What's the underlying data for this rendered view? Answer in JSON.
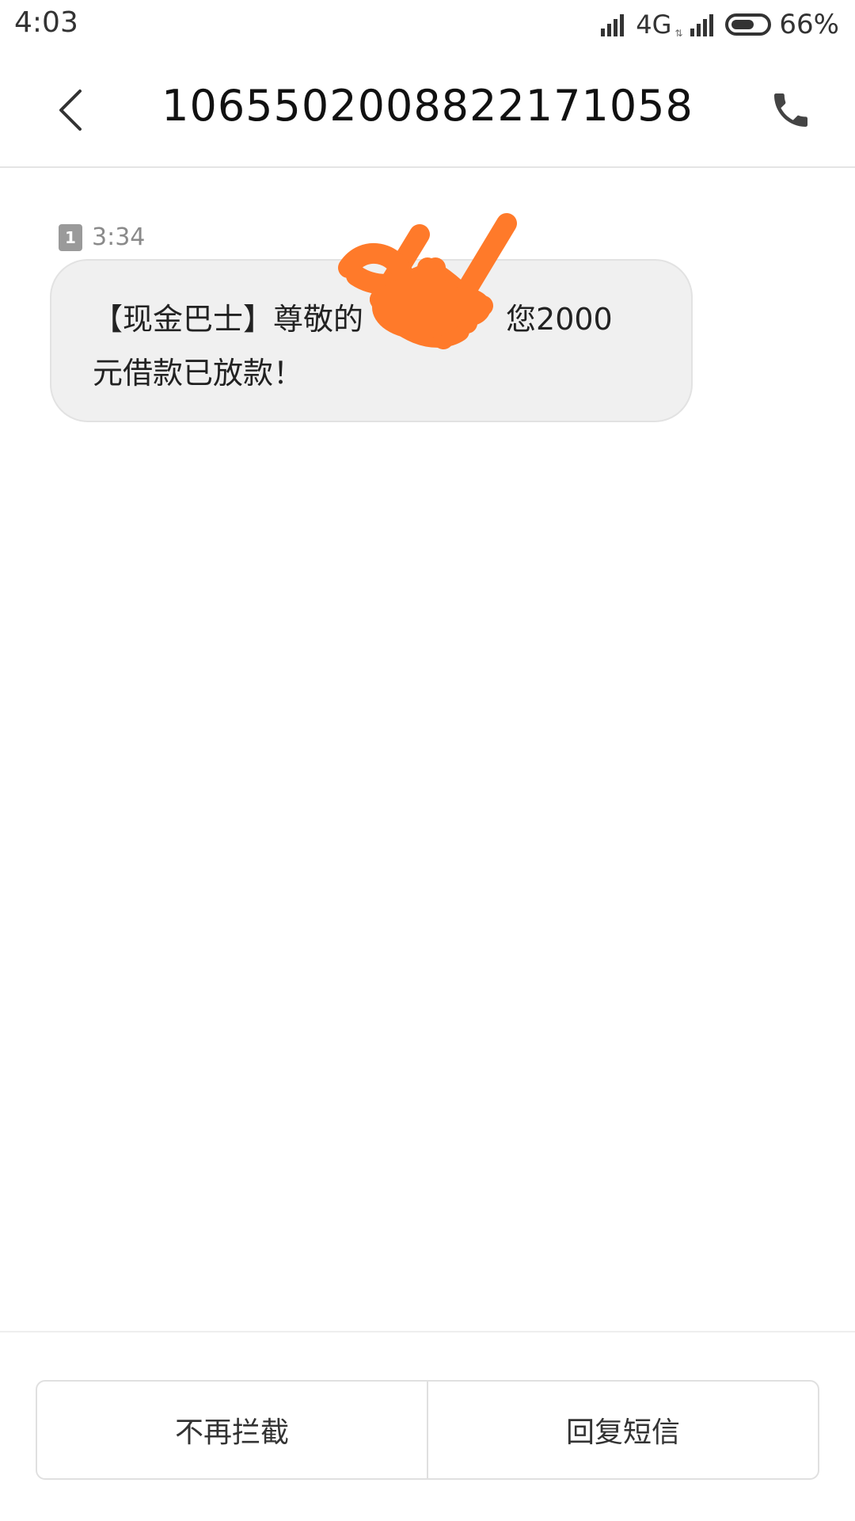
{
  "status_bar": {
    "time": "4:03",
    "network": "4G",
    "battery": "66%",
    "battery_level": 0.66
  },
  "header": {
    "title": "10655020088221710​58",
    "back_icon": "chevron-left-icon",
    "call_icon": "phone-icon"
  },
  "message": {
    "sim_label": "1",
    "time": "3:34",
    "line1_left": "【现金巴士】尊敬的",
    "line1_right": "您2000",
    "line2": "元借款已放款！"
  },
  "actions": {
    "unblock_label": "不再拦截",
    "reply_label": "回复短信"
  },
  "colors": {
    "bubble": "#f0f0f0",
    "redaction": "#ff7a2a"
  }
}
